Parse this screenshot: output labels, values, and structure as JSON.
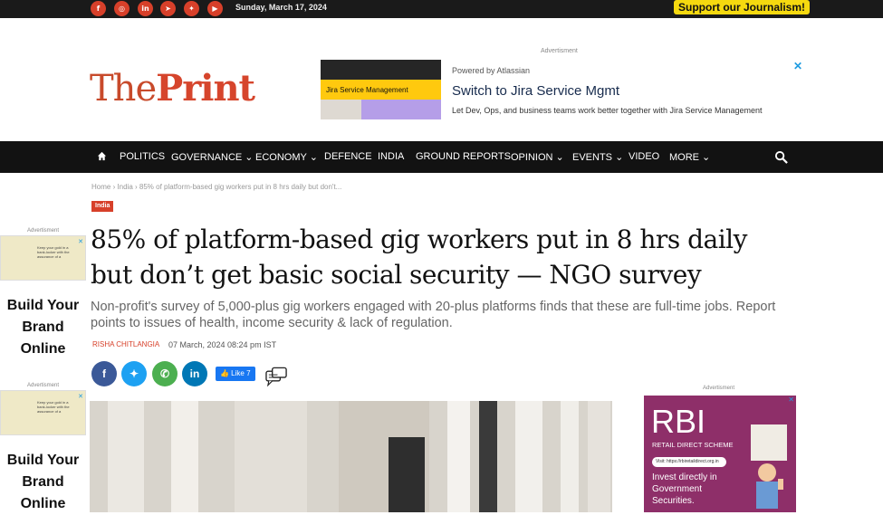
{
  "topbar": {
    "social": [
      {
        "name": "facebook-icon",
        "glyph": "f"
      },
      {
        "name": "instagram-icon",
        "glyph": "◎"
      },
      {
        "name": "linkedin-icon",
        "glyph": "in"
      },
      {
        "name": "telegram-icon",
        "glyph": "➤"
      },
      {
        "name": "twitter-icon",
        "glyph": "✦"
      },
      {
        "name": "youtube-icon",
        "glyph": "▶"
      }
    ],
    "date": "Sunday, March 17, 2024",
    "support": "Support our Journalism!"
  },
  "logo": {
    "the": "The",
    "print": "Print"
  },
  "header_ad": {
    "label": "Advertisment",
    "image_text": "Jira Service Management",
    "powered": "Powered by Atlassian",
    "title": "Switch to Jira Service Mgmt",
    "desc": "Let Dev, Ops, and business teams work better together with Jira Service Management",
    "close": "✕"
  },
  "nav": {
    "items": [
      "POLITICS",
      "GOVERNANCE ⌄",
      "ECONOMY ⌄",
      "DEFENCE",
      "INDIA",
      "GROUND REPORTS",
      "OPINION ⌄",
      "EVENTS ⌄",
      "VIDEO",
      "MORE ⌄"
    ]
  },
  "article": {
    "breadcrumb": "Home › India › 85% of platform-based gig workers put in 8 hrs daily but don't...",
    "tag": "India",
    "title": "85% of platform-based gig workers put in 8 hrs daily but don’t get basic social security — NGO survey",
    "subtitle": "Non-profit's survey of 5,000-plus gig workers engaged with 20-plus platforms finds that these are full-time jobs. Report points to issues of health, income security & lack of regulation.",
    "author": "RISHA CHITLANGIA",
    "time": "07 March, 2024 08:24 pm IST",
    "share": [
      {
        "name": "share-facebook-icon",
        "glyph": "f",
        "color": "#3b5998"
      },
      {
        "name": "share-twitter-icon",
        "glyph": "✦",
        "color": "#1da1f2"
      },
      {
        "name": "share-whatsapp-icon",
        "glyph": "✆",
        "color": "#4caf50"
      },
      {
        "name": "share-linkedin-icon",
        "glyph": "in",
        "color": "#0077b5"
      }
    ],
    "fb_like": "👍 Like 7"
  },
  "side_ads": [
    {
      "label": "Advertisment",
      "text": "Keep your gold in a bank-locker with the assurance of a",
      "big": "Build Your Brand Online"
    },
    {
      "label": "Advertisment",
      "text": "Keep your gold in a bank-locker with the assurance of a",
      "big": "Build Your Brand Online"
    }
  ],
  "right_ad": {
    "label": "Advertisment",
    "r": "RBI",
    "scheme": "RETAIL DIRECT SCHEME",
    "url": "Visit: https://rbiretaildirect.org.in",
    "invest": "Invest directly in Government Securities."
  },
  "colors": {
    "brand": "#d7402a",
    "nav_bg": "#121212",
    "support": "#f5d90f"
  }
}
